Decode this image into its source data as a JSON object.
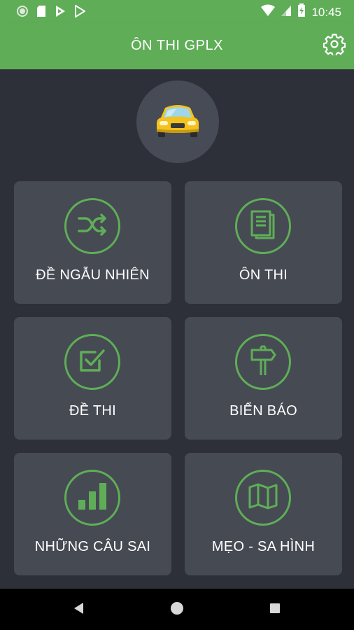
{
  "status_bar": {
    "time": "10:45",
    "icons": [
      "record-icon",
      "sd-card-icon",
      "play-store-icon",
      "play-store-outline-icon",
      "wifi-icon",
      "signal-icon",
      "battery-icon"
    ]
  },
  "app_bar": {
    "title": "ÔN THI GPLX",
    "settings_icon": "gear-icon"
  },
  "logo": {
    "icon": "taxi-car-icon"
  },
  "tiles": [
    {
      "label": "ĐỀ NGẪU NHIÊN",
      "icon": "shuffle-icon"
    },
    {
      "label": "ÔN THI",
      "icon": "book-icon"
    },
    {
      "label": "ĐỀ THI",
      "icon": "checkbox-icon"
    },
    {
      "label": "BIỂN BÁO",
      "icon": "signpost-icon"
    },
    {
      "label": "NHỮNG CÂU SAI",
      "icon": "bar-chart-icon"
    },
    {
      "label": "MẸO - SA HÌNH",
      "icon": "map-icon"
    }
  ],
  "colors": {
    "accent": "#5fae57",
    "background": "#2d3039",
    "tile": "#464a53",
    "car": "#f4c21f"
  },
  "nav_bar": {
    "icons": [
      "back-icon",
      "home-icon",
      "recents-icon"
    ]
  }
}
